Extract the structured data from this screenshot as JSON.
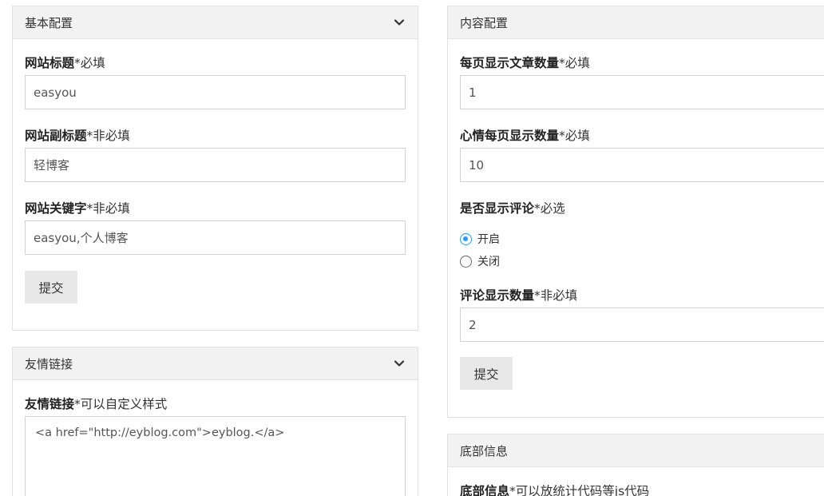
{
  "basic_config": {
    "title": "基本配置",
    "fields": [
      {
        "label": "网站标题",
        "hint": "*必填",
        "value": "easyou"
      },
      {
        "label": "网站副标题",
        "hint": "*非必填",
        "value": "轻博客"
      },
      {
        "label": "网站关键字",
        "hint": "*非必填",
        "value": "easyou,个人博客"
      }
    ],
    "submit_label": "提交"
  },
  "friend_links": {
    "title": "友情链接",
    "label": "友情链接",
    "hint": "*可以自定义样式",
    "value": "<a href=\"http://eyblog.com\">eyblog.</a>"
  },
  "content_config": {
    "title": "内容配置",
    "fields": [
      {
        "label": "每页显示文章数量",
        "hint": "*必填",
        "value": "1"
      },
      {
        "label": "心情每页显示数量",
        "hint": "*必填",
        "value": "10"
      }
    ],
    "comment_toggle": {
      "label": "是否显示评论",
      "hint": "*必选",
      "options": [
        "开启",
        "关闭"
      ],
      "selected": "开启"
    },
    "comment_count": {
      "label": "评论显示数量",
      "hint": "*非必填",
      "value": "2"
    },
    "submit_label": "提交"
  },
  "footer_info": {
    "title": "底部信息",
    "label": "底部信息",
    "hint": "*可以放统计代码等js代码"
  },
  "colors": {
    "accent": "#1e9fff",
    "panel_header": "#f2f2f2",
    "border": "#e2e2e2",
    "button": "#e8e8e8"
  }
}
